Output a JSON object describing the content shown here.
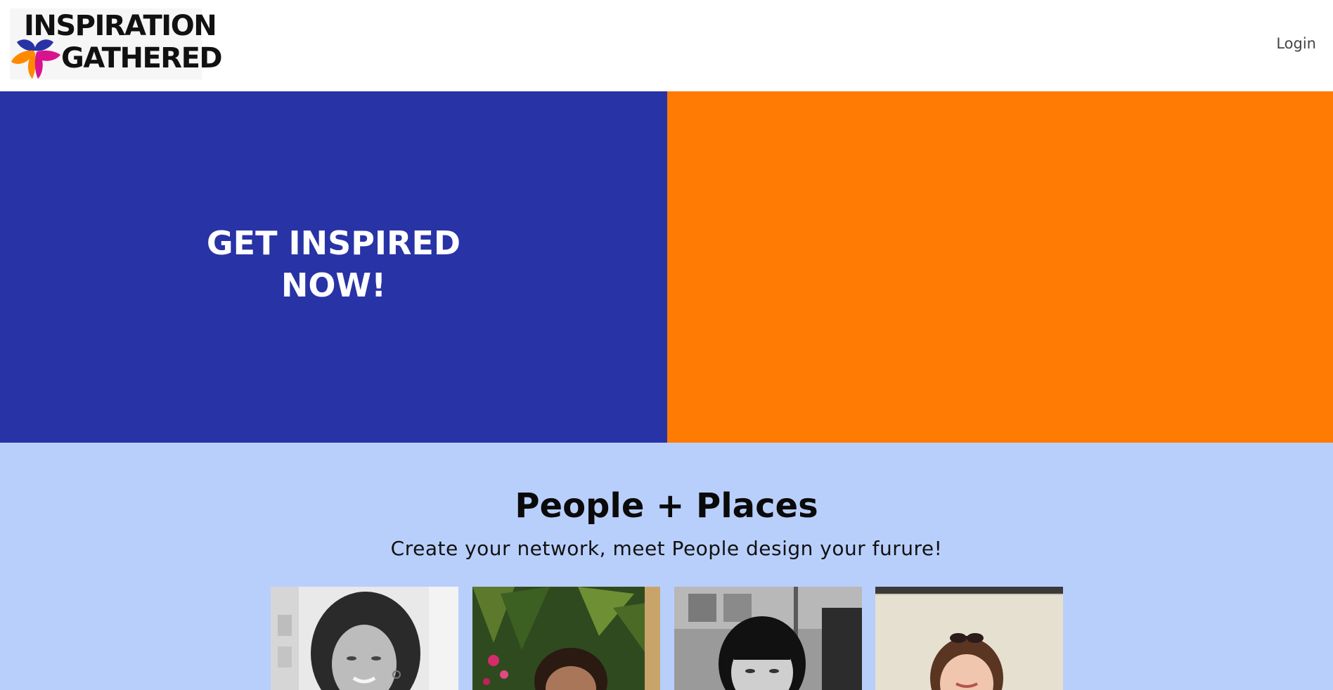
{
  "header": {
    "logo": {
      "line1": "INSPIRATION",
      "line2": "GATHERED",
      "colors": [
        "#2833a6",
        "#ff7b03",
        "#d9138f"
      ]
    },
    "login_label": "Login"
  },
  "hero": {
    "title_line1": "GET INSPIRED",
    "title_line2": "NOW!",
    "colors": {
      "left": "#2833a6",
      "right": "#ff7b03"
    }
  },
  "people_section": {
    "title": "People + Places",
    "subtitle": "Create your network, meet People design your furure!",
    "background": "#b9cffb",
    "cards": [
      {
        "photo": "woman-curly-hair-bw-photo"
      },
      {
        "photo": "woman-plants-color-photo"
      },
      {
        "photo": "woman-bangs-bw-photo"
      },
      {
        "photo": "woman-sunglasses-color-photo"
      }
    ]
  }
}
